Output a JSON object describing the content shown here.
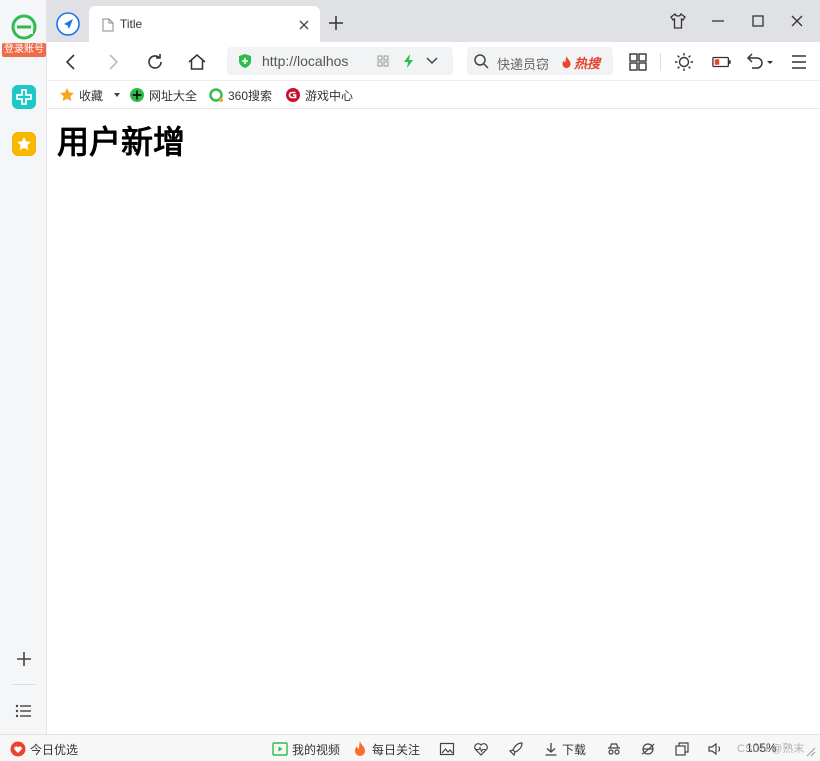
{
  "sidebar": {
    "login_label": "登录账号"
  },
  "tab": {
    "title": "Title"
  },
  "address_bar": {
    "url": "http://localhos"
  },
  "search_box": {
    "placeholder": "快递员窃",
    "hot_label": "热搜"
  },
  "bookmarks": [
    {
      "label": "收藏",
      "icon": "star-icon"
    },
    {
      "label": "网址大全",
      "icon": "globe-icon"
    },
    {
      "label": "360搜索",
      "icon": "search-360-icon"
    },
    {
      "label": "游戏中心",
      "icon": "game-center-icon"
    }
  ],
  "page": {
    "heading": "用户新增"
  },
  "status_bar": {
    "today_pick": "今日优选",
    "my_video": "我的视频",
    "daily_follow": "每日关注",
    "download": "下载",
    "zoom": "105%",
    "watermark": "CSDN @熟末"
  },
  "colors": {
    "accent_blue": "#1a73e8",
    "brand_green": "#2dbd4c",
    "login_badge": "#ef6b4a",
    "hot_red": "#e8442e"
  }
}
